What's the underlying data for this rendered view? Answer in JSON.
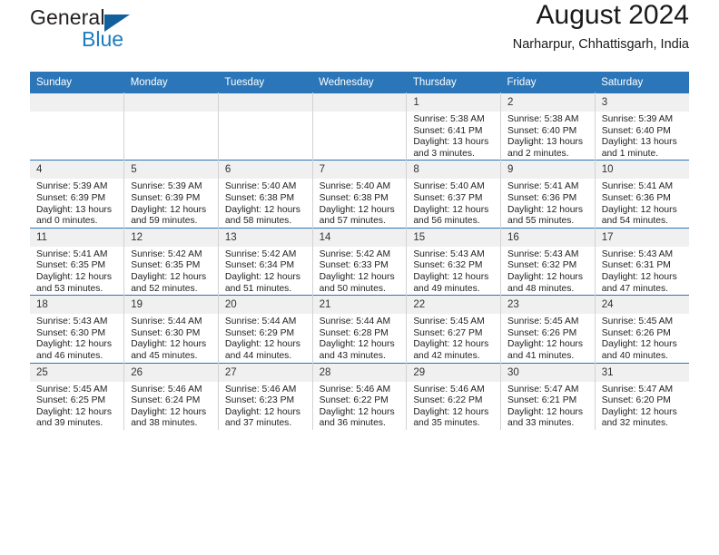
{
  "brand": {
    "word1": "General",
    "word2": "Blue",
    "triangle_color": "#10609e",
    "blue_text_color": "#1b7cc1"
  },
  "header": {
    "title": "August 2024",
    "subtitle": "Narharpur, Chhattisgarh, India",
    "header_bg": "#2b76b9",
    "daynum_bg": "#f0f0f0"
  },
  "weekdays": [
    "Sunday",
    "Monday",
    "Tuesday",
    "Wednesday",
    "Thursday",
    "Friday",
    "Saturday"
  ],
  "labels": {
    "sunrise_prefix": "Sunrise:",
    "sunset_prefix": "Sunset:",
    "daylight_prefix": "Daylight:"
  },
  "weeks": [
    [
      {
        "day": "",
        "empty": true
      },
      {
        "day": "",
        "empty": true
      },
      {
        "day": "",
        "empty": true
      },
      {
        "day": "",
        "empty": true
      },
      {
        "day": "1",
        "sunrise": "Sunrise: 5:38 AM",
        "sunset": "Sunset: 6:41 PM",
        "daylight": "Daylight: 13 hours and 3 minutes."
      },
      {
        "day": "2",
        "sunrise": "Sunrise: 5:38 AM",
        "sunset": "Sunset: 6:40 PM",
        "daylight": "Daylight: 13 hours and 2 minutes."
      },
      {
        "day": "3",
        "sunrise": "Sunrise: 5:39 AM",
        "sunset": "Sunset: 6:40 PM",
        "daylight": "Daylight: 13 hours and 1 minute."
      }
    ],
    [
      {
        "day": "4",
        "sunrise": "Sunrise: 5:39 AM",
        "sunset": "Sunset: 6:39 PM",
        "daylight": "Daylight: 13 hours and 0 minutes."
      },
      {
        "day": "5",
        "sunrise": "Sunrise: 5:39 AM",
        "sunset": "Sunset: 6:39 PM",
        "daylight": "Daylight: 12 hours and 59 minutes."
      },
      {
        "day": "6",
        "sunrise": "Sunrise: 5:40 AM",
        "sunset": "Sunset: 6:38 PM",
        "daylight": "Daylight: 12 hours and 58 minutes."
      },
      {
        "day": "7",
        "sunrise": "Sunrise: 5:40 AM",
        "sunset": "Sunset: 6:38 PM",
        "daylight": "Daylight: 12 hours and 57 minutes."
      },
      {
        "day": "8",
        "sunrise": "Sunrise: 5:40 AM",
        "sunset": "Sunset: 6:37 PM",
        "daylight": "Daylight: 12 hours and 56 minutes."
      },
      {
        "day": "9",
        "sunrise": "Sunrise: 5:41 AM",
        "sunset": "Sunset: 6:36 PM",
        "daylight": "Daylight: 12 hours and 55 minutes."
      },
      {
        "day": "10",
        "sunrise": "Sunrise: 5:41 AM",
        "sunset": "Sunset: 6:36 PM",
        "daylight": "Daylight: 12 hours and 54 minutes."
      }
    ],
    [
      {
        "day": "11",
        "sunrise": "Sunrise: 5:41 AM",
        "sunset": "Sunset: 6:35 PM",
        "daylight": "Daylight: 12 hours and 53 minutes."
      },
      {
        "day": "12",
        "sunrise": "Sunrise: 5:42 AM",
        "sunset": "Sunset: 6:35 PM",
        "daylight": "Daylight: 12 hours and 52 minutes."
      },
      {
        "day": "13",
        "sunrise": "Sunrise: 5:42 AM",
        "sunset": "Sunset: 6:34 PM",
        "daylight": "Daylight: 12 hours and 51 minutes."
      },
      {
        "day": "14",
        "sunrise": "Sunrise: 5:42 AM",
        "sunset": "Sunset: 6:33 PM",
        "daylight": "Daylight: 12 hours and 50 minutes."
      },
      {
        "day": "15",
        "sunrise": "Sunrise: 5:43 AM",
        "sunset": "Sunset: 6:32 PM",
        "daylight": "Daylight: 12 hours and 49 minutes."
      },
      {
        "day": "16",
        "sunrise": "Sunrise: 5:43 AM",
        "sunset": "Sunset: 6:32 PM",
        "daylight": "Daylight: 12 hours and 48 minutes."
      },
      {
        "day": "17",
        "sunrise": "Sunrise: 5:43 AM",
        "sunset": "Sunset: 6:31 PM",
        "daylight": "Daylight: 12 hours and 47 minutes."
      }
    ],
    [
      {
        "day": "18",
        "sunrise": "Sunrise: 5:43 AM",
        "sunset": "Sunset: 6:30 PM",
        "daylight": "Daylight: 12 hours and 46 minutes."
      },
      {
        "day": "19",
        "sunrise": "Sunrise: 5:44 AM",
        "sunset": "Sunset: 6:30 PM",
        "daylight": "Daylight: 12 hours and 45 minutes."
      },
      {
        "day": "20",
        "sunrise": "Sunrise: 5:44 AM",
        "sunset": "Sunset: 6:29 PM",
        "daylight": "Daylight: 12 hours and 44 minutes."
      },
      {
        "day": "21",
        "sunrise": "Sunrise: 5:44 AM",
        "sunset": "Sunset: 6:28 PM",
        "daylight": "Daylight: 12 hours and 43 minutes."
      },
      {
        "day": "22",
        "sunrise": "Sunrise: 5:45 AM",
        "sunset": "Sunset: 6:27 PM",
        "daylight": "Daylight: 12 hours and 42 minutes."
      },
      {
        "day": "23",
        "sunrise": "Sunrise: 5:45 AM",
        "sunset": "Sunset: 6:26 PM",
        "daylight": "Daylight: 12 hours and 41 minutes."
      },
      {
        "day": "24",
        "sunrise": "Sunrise: 5:45 AM",
        "sunset": "Sunset: 6:26 PM",
        "daylight": "Daylight: 12 hours and 40 minutes."
      }
    ],
    [
      {
        "day": "25",
        "sunrise": "Sunrise: 5:45 AM",
        "sunset": "Sunset: 6:25 PM",
        "daylight": "Daylight: 12 hours and 39 minutes."
      },
      {
        "day": "26",
        "sunrise": "Sunrise: 5:46 AM",
        "sunset": "Sunset: 6:24 PM",
        "daylight": "Daylight: 12 hours and 38 minutes."
      },
      {
        "day": "27",
        "sunrise": "Sunrise: 5:46 AM",
        "sunset": "Sunset: 6:23 PM",
        "daylight": "Daylight: 12 hours and 37 minutes."
      },
      {
        "day": "28",
        "sunrise": "Sunrise: 5:46 AM",
        "sunset": "Sunset: 6:22 PM",
        "daylight": "Daylight: 12 hours and 36 minutes."
      },
      {
        "day": "29",
        "sunrise": "Sunrise: 5:46 AM",
        "sunset": "Sunset: 6:22 PM",
        "daylight": "Daylight: 12 hours and 35 minutes."
      },
      {
        "day": "30",
        "sunrise": "Sunrise: 5:47 AM",
        "sunset": "Sunset: 6:21 PM",
        "daylight": "Daylight: 12 hours and 33 minutes."
      },
      {
        "day": "31",
        "sunrise": "Sunrise: 5:47 AM",
        "sunset": "Sunset: 6:20 PM",
        "daylight": "Daylight: 12 hours and 32 minutes."
      }
    ]
  ]
}
